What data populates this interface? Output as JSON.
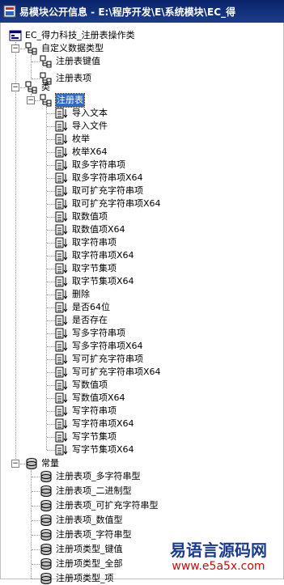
{
  "window": {
    "title": "易模块公开信息 - E:\\程序开发\\E\\系统模块\\EC_得"
  },
  "tree": {
    "root": {
      "label": "EC_得力科技_注册表操作类"
    },
    "custom_types": {
      "label": "自定义数据类型",
      "items": [
        "注册表键值",
        "注册表项"
      ]
    },
    "classes": {
      "label": "类",
      "class_name": "注册表",
      "methods": [
        "导入文本",
        "导入文件",
        "枚举",
        "枚举X64",
        "取多字符串项",
        "取多字符串项X64",
        "取可扩充字符串项",
        "取可扩充字符串项X64",
        "取数值项",
        "取数值项X64",
        "取字符串项",
        "取字符串项X64",
        "取字节集项",
        "取字节集项X64",
        "删除",
        "是否64位",
        "是否存在",
        "写多字符串项",
        "写多字符串项X64",
        "写可扩充字符串项",
        "写可扩充字符串项X64",
        "写数值项",
        "写数值项X64",
        "写字符串项",
        "写字符串项X64",
        "写字节集项",
        "写字节集项X64"
      ]
    },
    "constants": {
      "label": "常量",
      "items": [
        "注册表项_多字符串型",
        "注册表项_二进制型",
        "注册表项_可扩充字符串型",
        "注册表项_数值型",
        "注册表项_字符串型",
        "注册项类型_键值",
        "注册项类型_全部",
        "注册项类型_项"
      ]
    }
  },
  "watermark": {
    "line1": "易语言源码网",
    "line2": "www.e5a5x.com"
  }
}
